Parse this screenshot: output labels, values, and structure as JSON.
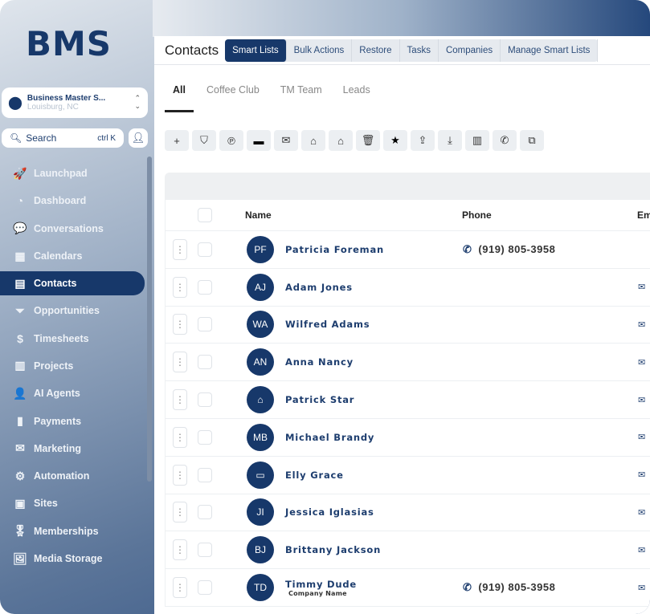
{
  "logo": "BMS",
  "business": {
    "name": "Business Master S...",
    "location": "Louisburg, NC"
  },
  "search": {
    "label": "Search",
    "shortcut": "ctrl K"
  },
  "nav": [
    {
      "label": "Launchpad",
      "icon": "🚀"
    },
    {
      "label": "Dashboard",
      "icon": "◔"
    },
    {
      "label": "Conversations",
      "icon": "💬"
    },
    {
      "label": "Calendars",
      "icon": "▦"
    },
    {
      "label": "Contacts",
      "icon": "▤",
      "active": true
    },
    {
      "label": "Opportunities",
      "icon": "⏷"
    },
    {
      "label": "Timesheets",
      "icon": "$"
    },
    {
      "label": "Projects",
      "icon": "▥"
    },
    {
      "label": "AI Agents",
      "icon": "👤"
    },
    {
      "label": "Payments",
      "icon": "▮"
    },
    {
      "label": "Marketing",
      "icon": "✉"
    },
    {
      "label": "Automation",
      "icon": "⚙"
    },
    {
      "label": "Sites",
      "icon": "▣"
    },
    {
      "label": "Memberships",
      "icon": "🎖"
    },
    {
      "label": "Media Storage",
      "icon": "🖼"
    }
  ],
  "header": {
    "title": "Contacts",
    "tabs": [
      "Smart Lists",
      "Bulk Actions",
      "Restore",
      "Tasks",
      "Companies",
      "Manage Smart Lists"
    ]
  },
  "subtabs": [
    "All",
    "Coffee Club",
    "TM Team",
    "Leads"
  ],
  "toolbar": [
    {
      "name": "add",
      "g": "+"
    },
    {
      "name": "filter",
      "g": "⛉"
    },
    {
      "name": "automation",
      "g": "℗"
    },
    {
      "name": "sms",
      "g": "▬"
    },
    {
      "name": "email",
      "g": "✉"
    },
    {
      "name": "add-tag",
      "g": "⌂"
    },
    {
      "name": "remove-tag",
      "g": "⌂"
    },
    {
      "name": "delete",
      "g": "🗑"
    },
    {
      "name": "star",
      "g": "★"
    },
    {
      "name": "export",
      "g": "⇪"
    },
    {
      "name": "import",
      "g": "⤓"
    },
    {
      "name": "company",
      "g": "▥"
    },
    {
      "name": "whatsapp",
      "g": "✆"
    },
    {
      "name": "duplicate",
      "g": "⧉"
    }
  ],
  "columns": {
    "name": "Name",
    "phone": "Phone",
    "email": "Em"
  },
  "contacts": [
    {
      "initials": "PF",
      "name": "Patricia Foreman",
      "phone": "(919) 805-3958"
    },
    {
      "initials": "AJ",
      "name": "Adam Jones"
    },
    {
      "initials": "WA",
      "name": "Wilfred Adams"
    },
    {
      "initials": "AN",
      "name": "Anna Nancy"
    },
    {
      "initials": "⌂",
      "name": "Patrick Star"
    },
    {
      "initials": "MB",
      "name": "Michael Brandy"
    },
    {
      "initials": "▭",
      "name": "Elly Grace"
    },
    {
      "initials": "JI",
      "name": "Jessica Iglasias"
    },
    {
      "initials": "BJ",
      "name": "Brittany Jackson"
    },
    {
      "initials": "TD",
      "name": "Timmy Dude",
      "company": "Company Name",
      "phone": "(919) 805-3958"
    }
  ]
}
